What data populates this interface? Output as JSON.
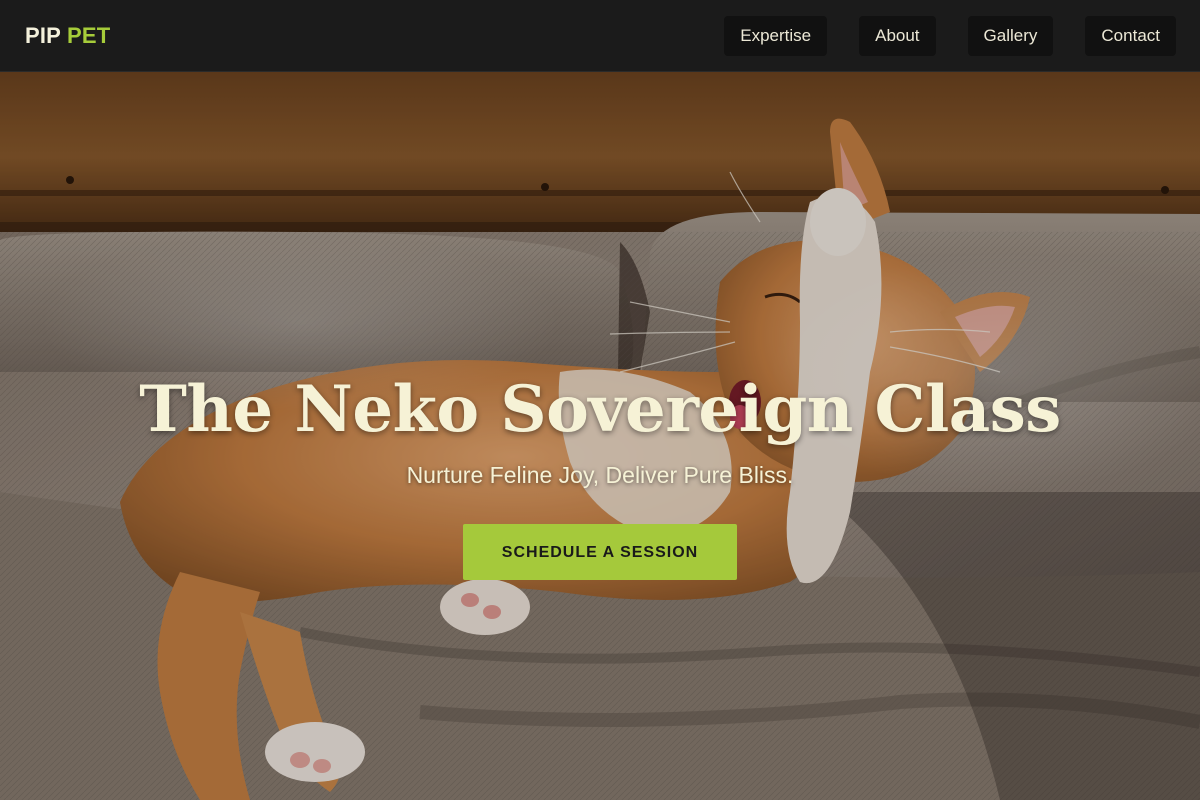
{
  "brand": {
    "logo_part_1": "PIP",
    "logo_part_2": "PET"
  },
  "nav": {
    "items": [
      {
        "label": "Expertise"
      },
      {
        "label": "About"
      },
      {
        "label": "Gallery"
      },
      {
        "label": "Contact"
      }
    ]
  },
  "hero": {
    "title": "The Neko Sovereign Class",
    "subtitle": "Nurture Feline Joy, Deliver Pure Bliss.",
    "cta_label": "SCHEDULE A SESSION"
  },
  "colors": {
    "nav_background": "#1b1b1b",
    "nav_button_background": "#111111",
    "accent_green": "#a6cc3a",
    "cream_text": "#f6f2d6"
  }
}
